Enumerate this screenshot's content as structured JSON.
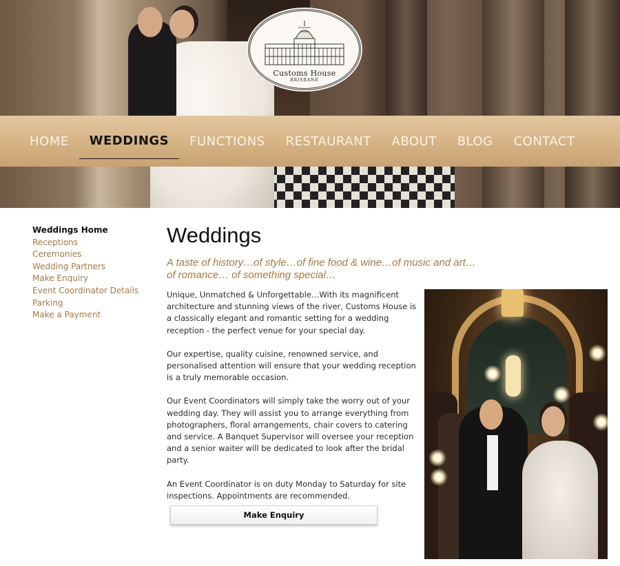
{
  "header": {
    "logo": {
      "name": "Customs House",
      "sub": "BRISBANE"
    }
  },
  "nav": {
    "items": [
      {
        "label": "HOME"
      },
      {
        "label": "WEDDINGS"
      },
      {
        "label": "FUNCTIONS"
      },
      {
        "label": "RESTAURANT"
      },
      {
        "label": "ABOUT"
      },
      {
        "label": "BLOG"
      },
      {
        "label": "CONTACT"
      }
    ],
    "active": "WEDDINGS"
  },
  "sidebar": {
    "items": [
      {
        "label": "Weddings Home"
      },
      {
        "label": "Receptions"
      },
      {
        "label": "Ceremonies"
      },
      {
        "label": "Wedding Partners"
      },
      {
        "label": "Make Enquiry"
      },
      {
        "label": "Event Coordinator Details"
      },
      {
        "label": "Parking"
      },
      {
        "label": "Make a Payment"
      }
    ],
    "current": "Weddings Home"
  },
  "main": {
    "title": "Weddings",
    "tagline_line1": "A taste of history…of style…of fine food & wine…of music and art…",
    "tagline_line2": "of romance… of something special…",
    "paragraphs": [
      "Unique, Unmatched & Unforgettable…With its magnificent architecture and stunning views of the river, Customs House is a classically elegant and romantic setting for a wedding reception - the perfect venue for your special day.",
      "Our expertise, quality cuisine, renowned service, and personalised attention will ensure that your wedding reception is a truly memorable occasion.",
      "Our Event Coordinators will simply take the worry out of your wedding day. They will assist you to arrange everything from photographers, floral arrangements, chair covers to catering and service. A Banquet Supervisor will oversee your reception and a senior waiter will be dedicated to look after the bridal party.",
      "An Event Coordinator is on duty Monday to Saturday for site inspections. Appointments are recommended."
    ],
    "enquiry_button": "Make Enquiry"
  },
  "colors": {
    "accent": "#a57a46",
    "nav_band": "#d6b486",
    "nav_text": "#fbf3e6",
    "active_nav": "#151515"
  }
}
